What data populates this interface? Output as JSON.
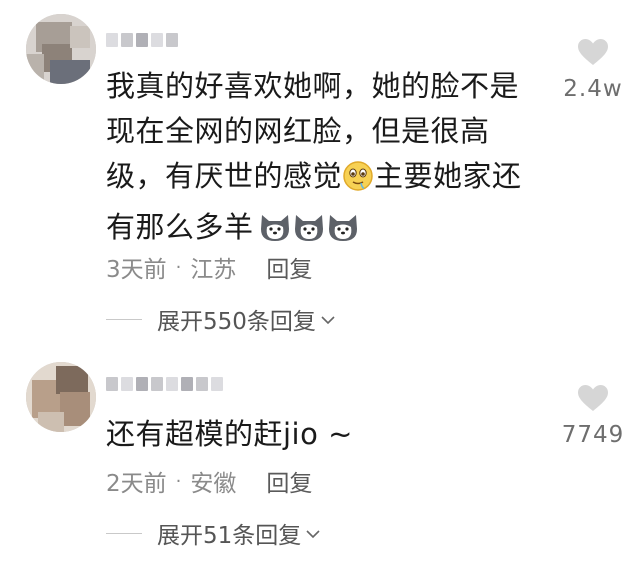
{
  "comments": [
    {
      "text_before_emoji": "我真的好喜欢她啊，她的脸不是现在全网的网红脸，但是很高级，有厌世的感觉",
      "text_after_emoji": "主要她家还有那么多羊",
      "emoji": "drooling-face-emoji",
      "trailing_emojis": [
        "husky-emoji",
        "husky-emoji",
        "husky-emoji"
      ],
      "time": "3天前",
      "location": "江苏",
      "reply_label": "回复",
      "like_count": "2.4w",
      "expand_label": "展开550条回复"
    },
    {
      "text": "还有超模的赶jio ~",
      "time": "2天前",
      "location": "安徽",
      "reply_label": "回复",
      "like_count": "7749",
      "expand_label": "展开51条回复"
    }
  ],
  "separator": "·",
  "icons": {
    "like": "heart-icon",
    "expand": "chevron-down-icon"
  },
  "colors": {
    "text": "#1a1a1a",
    "meta": "#8a8a8a",
    "heart": "#d6d6d6"
  }
}
